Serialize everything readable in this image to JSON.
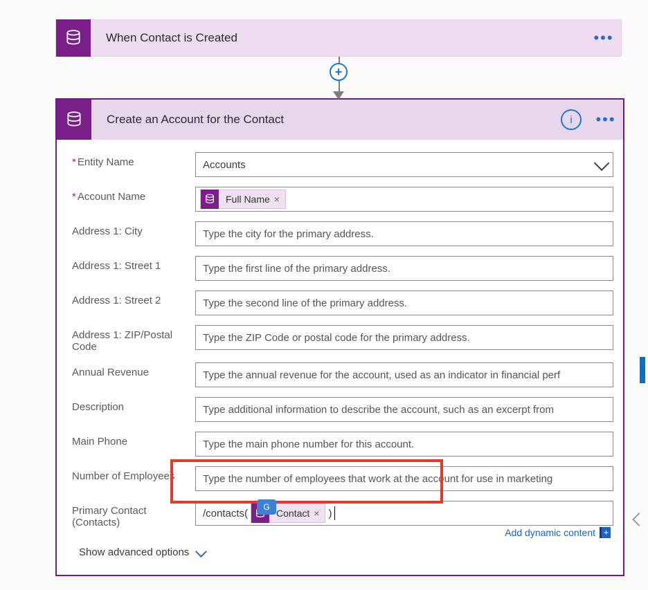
{
  "trigger": {
    "title": "When Contact is Created"
  },
  "action": {
    "title": "Create an Account for the Contact",
    "fields": {
      "entity_name": {
        "label": "Entity Name",
        "required": true,
        "value": "Accounts"
      },
      "account_name": {
        "label": "Account Name",
        "required": true,
        "token": "Full Name"
      },
      "address_city": {
        "label": "Address 1: City",
        "placeholder": "Type the city for the primary address."
      },
      "address_street1": {
        "label": "Address 1: Street 1",
        "placeholder": "Type the first line of the primary address."
      },
      "address_street2": {
        "label": "Address 1: Street 2",
        "placeholder": "Type the second line of the primary address."
      },
      "address_zip": {
        "label": "Address 1: ZIP/Postal Code",
        "placeholder": "Type the ZIP Code or postal code for the primary address."
      },
      "annual_revenue": {
        "label": "Annual Revenue",
        "placeholder": "Type the annual revenue for the account, used as an indicator in financial perf"
      },
      "description": {
        "label": "Description",
        "placeholder": "Type additional information to describe the account, such as an excerpt from "
      },
      "main_phone": {
        "label": "Main Phone",
        "placeholder": "Type the main phone number for this account."
      },
      "num_employees": {
        "label": "Number of Employees",
        "placeholder": "Type the number of employees that work at the account for use in marketing "
      },
      "primary_contact": {
        "label": "Primary Contact (Contacts)",
        "prefix": "/contacts(",
        "token": "Contact",
        "suffix": ")"
      }
    },
    "dynamic_content_label": "Add dynamic content",
    "advanced_label": "Show advanced options"
  }
}
